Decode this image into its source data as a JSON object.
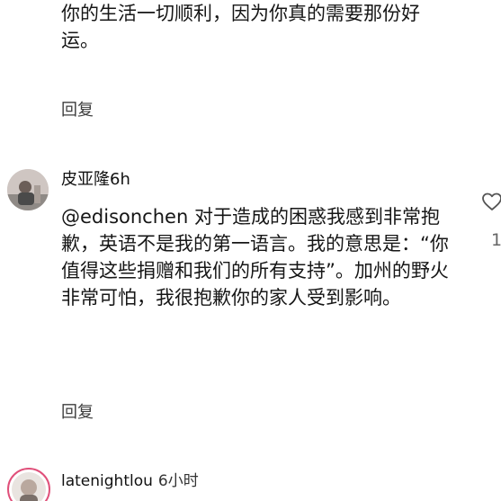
{
  "previous_comment": {
    "text": "你的生活一切顺利，因为你真的需要那份好运。",
    "reply_label": "回复"
  },
  "comment": {
    "username": "皮亚隆",
    "time": "6h",
    "text": "@edisonchen 对于造成的困惑我感到非常抱歉，英语不是我的第一语言。我的意思是：“你值得这些捐赠和我们的所有支持”。加州的野火非常可怕，我很抱歉你的家人受到影响。",
    "reply_label": "回复",
    "like_count": "1"
  },
  "next_comment": {
    "username": "latenightlou",
    "time": "6小时"
  }
}
